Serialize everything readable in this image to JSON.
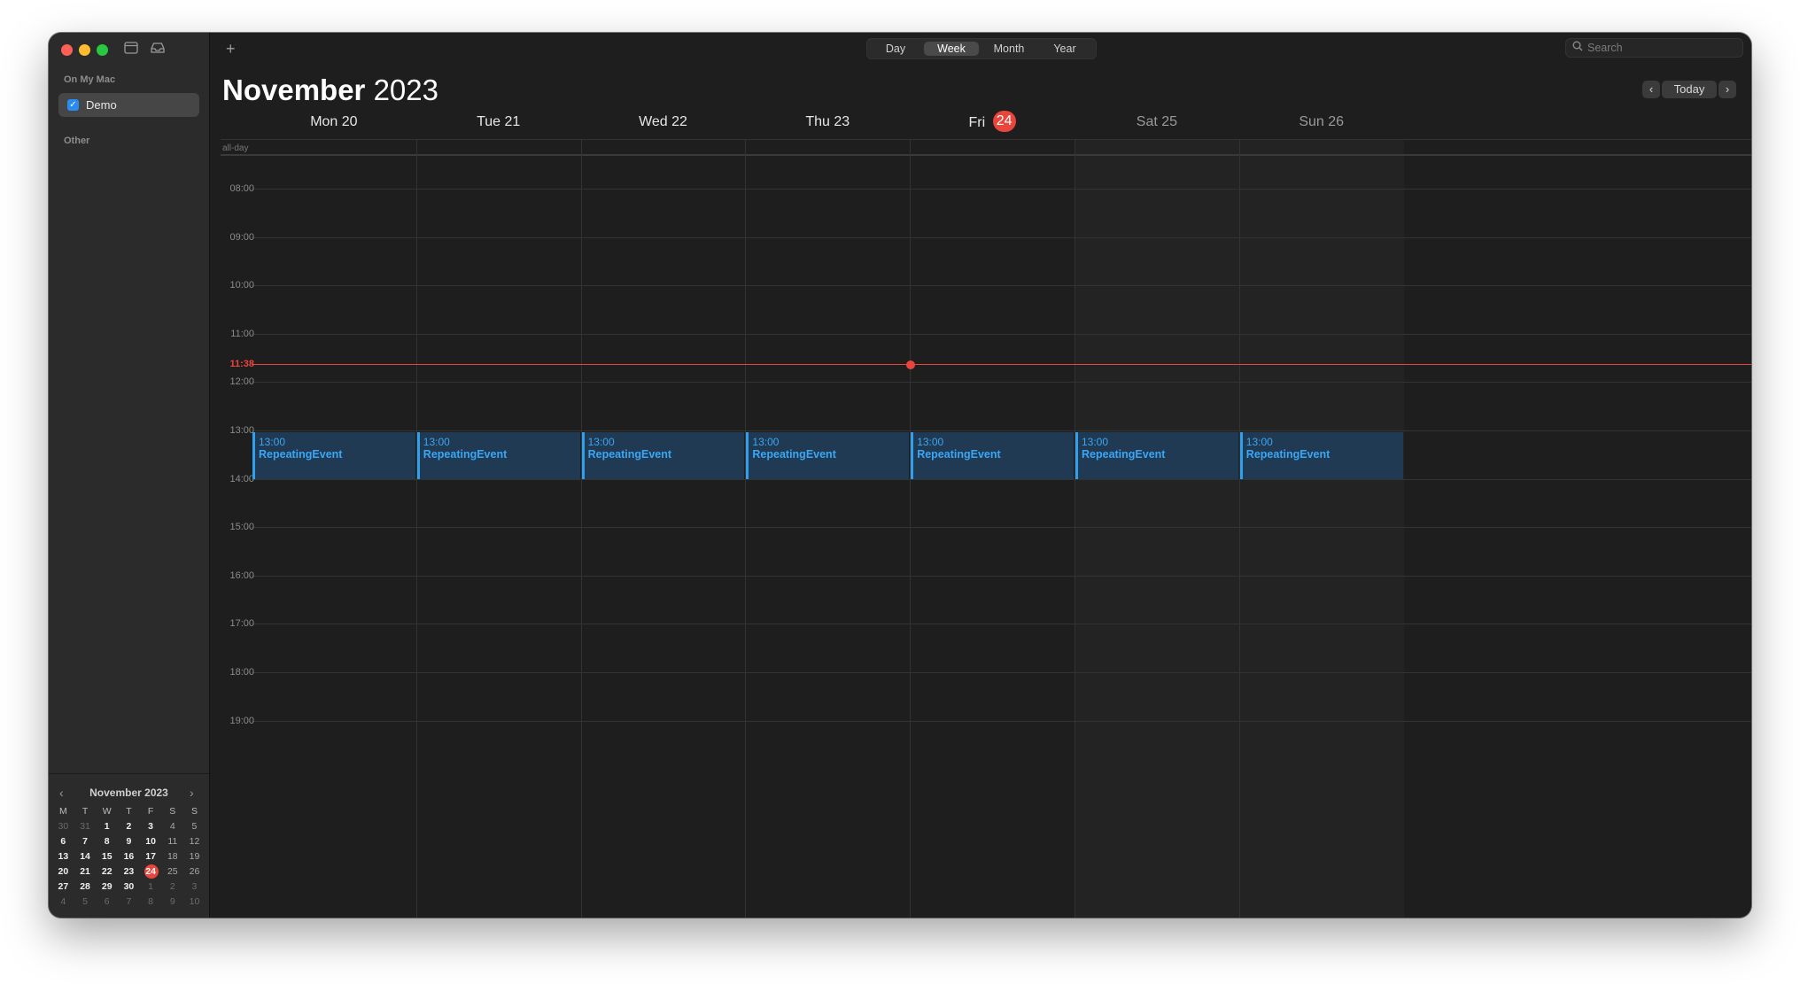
{
  "sidebar": {
    "section_on_my_mac": "On My Mac",
    "calendar_item": {
      "label": "Demo",
      "checked": true
    },
    "section_other": "Other",
    "mini_calendar": {
      "title": "November 2023",
      "weekdays": [
        "M",
        "T",
        "W",
        "T",
        "F",
        "S",
        "S"
      ],
      "rows": [
        [
          "30",
          "31",
          "1",
          "2",
          "3",
          "4",
          "5"
        ],
        [
          "6",
          "7",
          "8",
          "9",
          "10",
          "11",
          "12"
        ],
        [
          "13",
          "14",
          "15",
          "16",
          "17",
          "18",
          "19"
        ],
        [
          "20",
          "21",
          "22",
          "23",
          "24",
          "25",
          "26"
        ],
        [
          "27",
          "28",
          "29",
          "30",
          "1",
          "2",
          "3"
        ],
        [
          "4",
          "5",
          "6",
          "7",
          "8",
          "9",
          "10"
        ]
      ],
      "today": "24"
    }
  },
  "toolbar": {
    "add_label": "+",
    "views": [
      "Day",
      "Week",
      "Month",
      "Year"
    ],
    "active_view": "Week",
    "search_placeholder": "Search"
  },
  "header": {
    "month": "November",
    "year": "2023",
    "today_label": "Today",
    "prev_icon": "chevron-left-icon",
    "next_icon": "chevron-right-icon"
  },
  "week": {
    "days": [
      {
        "name": "Mon",
        "date": "20",
        "weekend": false,
        "today": false
      },
      {
        "name": "Tue",
        "date": "21",
        "weekend": false,
        "today": false
      },
      {
        "name": "Wed",
        "date": "22",
        "weekend": false,
        "today": false
      },
      {
        "name": "Thu",
        "date": "23",
        "weekend": false,
        "today": false
      },
      {
        "name": "Fri",
        "date": "24",
        "weekend": false,
        "today": true
      },
      {
        "name": "Sat",
        "date": "25",
        "weekend": true,
        "today": false
      },
      {
        "name": "Sun",
        "date": "26",
        "weekend": true,
        "today": false
      }
    ],
    "all_day_label": "all-day",
    "hours": [
      "08:00",
      "09:00",
      "10:00",
      "11:00",
      "12:00",
      "13:00",
      "14:00",
      "15:00",
      "16:00",
      "17:00",
      "18:00",
      "19:00"
    ],
    "current_time": "11:38",
    "events": [
      {
        "day": 0,
        "time": "13:00",
        "title": "RepeatingEvent"
      },
      {
        "day": 1,
        "time": "13:00",
        "title": "RepeatingEvent"
      },
      {
        "day": 2,
        "time": "13:00",
        "title": "RepeatingEvent"
      },
      {
        "day": 3,
        "time": "13:00",
        "title": "RepeatingEvent"
      },
      {
        "day": 4,
        "time": "13:00",
        "title": "RepeatingEvent"
      },
      {
        "day": 5,
        "time": "13:00",
        "title": "RepeatingEvent"
      },
      {
        "day": 6,
        "time": "13:00",
        "title": "RepeatingEvent"
      }
    ]
  },
  "colors": {
    "accent": "#2a8cf0",
    "today_red": "#e8453c",
    "event_fill": "#1f3a52",
    "event_text": "#3ba6f5"
  }
}
